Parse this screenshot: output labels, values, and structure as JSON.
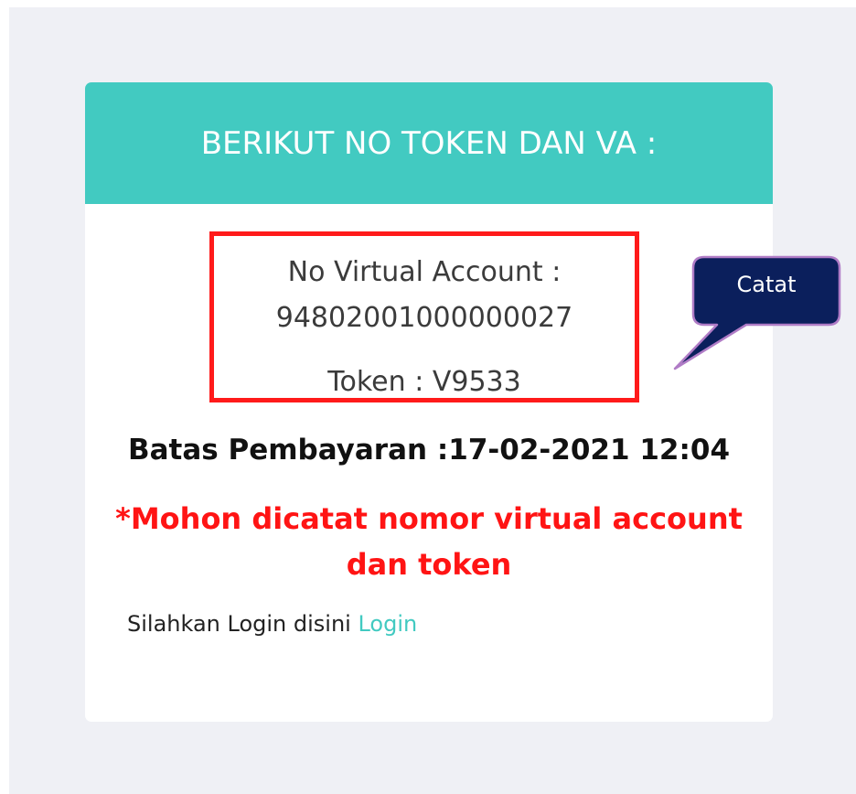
{
  "header": {
    "title": "BERIKUT NO TOKEN DAN VA :"
  },
  "va_box": {
    "label": "No Virtual Account :",
    "number": "94802001000000027",
    "token": "Token : V9533"
  },
  "deadline": {
    "text": "Batas Pembayaran :17-02-2021 12:04"
  },
  "notice": {
    "text": "*Mohon dicatat nomor virtual account dan token"
  },
  "login": {
    "prompt": "Silahkan Login disini",
    "link_label": "Login"
  },
  "callout": {
    "text": "Catat"
  },
  "colors": {
    "header_bg": "#42cac1",
    "highlight_border": "#ff1a1a",
    "notice_text": "#ff1414",
    "callout_bg": "#0b1f5c",
    "callout_border": "#b07cc6",
    "link": "#42cac1",
    "page_bg": "#eff0f5"
  }
}
